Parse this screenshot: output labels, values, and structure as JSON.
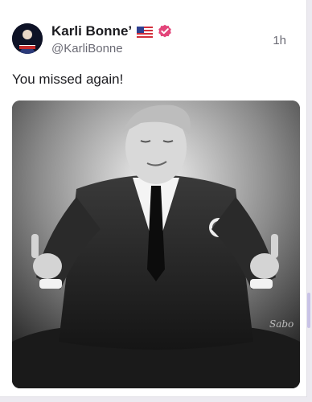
{
  "post": {
    "author_name": "Karli Bonne’",
    "handle": "@KarliBonne",
    "timestamp": "1h",
    "text": "You missed again!",
    "flag_icon": "us-flag-icon",
    "verified_icon": "verified-badge-icon",
    "verified_color": "#e3457a",
    "image_watermark": "Sabo"
  }
}
